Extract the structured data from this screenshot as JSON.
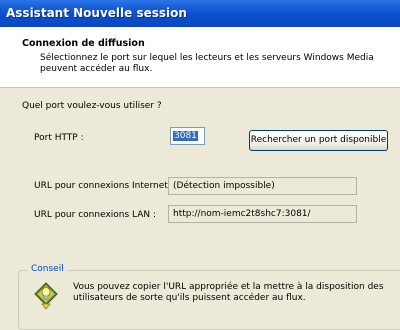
{
  "window": {
    "title": "Assistant Nouvelle session"
  },
  "header": {
    "title": "Connexion de diffusion",
    "description": "Sélectionnez le port sur lequel les lecteurs et les serveurs Windows Media peuvent accéder au flux."
  },
  "question": "Quel port voulez-vous utiliser ?",
  "port": {
    "label": "Port HTTP :",
    "value": "3081",
    "search_button": "Rechercher un port disponible"
  },
  "internet": {
    "label": "URL pour connexions Internet :",
    "value": "(Détection impossible)"
  },
  "lan": {
    "label": "URL pour connexions LAN :",
    "value": "http://nom-iemc2t8shc7:3081/"
  },
  "tip": {
    "legend": "Conseil",
    "text": "Vous pouvez copier l'URL appropriée et la mettre à la disposition des utilisateurs de sorte qu'ils puissent accéder au flux.",
    "icon": "lightbulb-icon"
  }
}
